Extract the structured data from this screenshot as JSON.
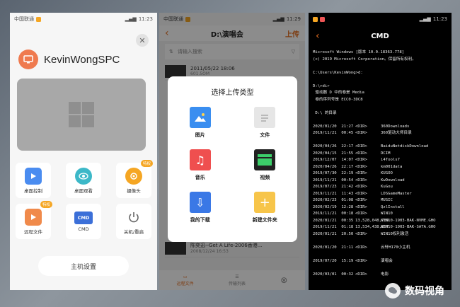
{
  "phone1": {
    "status": {
      "carrier": "中国联通",
      "time": "11:23"
    },
    "device_name": "KevinWongSPC",
    "functions": [
      {
        "label": "桌面控制",
        "icon": "play-icon",
        "tag": ""
      },
      {
        "label": "桌面观看",
        "icon": "eye-icon",
        "tag": ""
      },
      {
        "label": "摄像头",
        "icon": "camera-icon",
        "tag": "特权"
      },
      {
        "label": "远程文件",
        "icon": "folder-icon",
        "tag": "特权"
      },
      {
        "label": "CMD",
        "icon": "cmd-icon",
        "tag": ""
      },
      {
        "label": "关机/重启",
        "icon": "power-icon",
        "tag": ""
      }
    ],
    "host_settings_label": "主机设置",
    "colors": {
      "accent": "#ef7a4f",
      "blue": "#4a8cf0",
      "orange": "#f5a623"
    }
  },
  "phone2": {
    "status": {
      "carrier": "中国联通",
      "time": "11:29"
    },
    "path_title": "D:\\演唱会",
    "upload_label": "上传",
    "search_placeholder": "请输入搜索",
    "list": [
      {
        "name": "2011/05/22 18:06",
        "meta": "601.5OM"
      },
      {
        "name": "陈奕迅--Get A Life-2006香港...",
        "meta": "2008/12/24 16:53"
      }
    ],
    "dialog": {
      "title": "选择上传类型",
      "types": [
        {
          "label": "图片",
          "icon": "image-icon"
        },
        {
          "label": "文件",
          "icon": "file-icon"
        },
        {
          "label": "音乐",
          "icon": "music-icon"
        },
        {
          "label": "视频",
          "icon": "video-icon"
        },
        {
          "label": "我的下载",
          "icon": "download-icon"
        },
        {
          "label": "新建文件夹",
          "icon": "new-folder-icon"
        }
      ]
    },
    "bottom_nav": [
      "远程文件",
      "传输列表",
      ""
    ]
  },
  "phone3": {
    "status": {
      "time": "11:23"
    },
    "title": "CMD",
    "header_lines": [
      "Microsoft Windows [版本 10.0.18363.778]",
      "(c) 2019 Microsoft Corporation。保留所有权利。",
      "",
      "C:\\Users\\KevinWong>d:",
      "",
      "D:\\>dir",
      " 驱动器 D 中的卷是 Media",
      " 卷的序列号是 ECC0-3DC8",
      "",
      " D:\\ 的目录",
      ""
    ],
    "dir_rows": [
      {
        "date": "2020/01/20",
        "time": "21:27",
        "tag": "<DIR>",
        "name": "360Downloads"
      },
      {
        "date": "2019/11/21",
        "time": "00:45",
        "tag": "<DIR>",
        "name": "360驱动大师目录"
      },
      {
        "date": "",
        "time": "",
        "tag": "",
        "name": ""
      },
      {
        "date": "2020/04/26",
        "time": "22:17",
        "tag": "<DIR>",
        "name": "BaiduNetdiskDownload"
      },
      {
        "date": "2020/04/15",
        "time": "21:55",
        "tag": "<DIR>",
        "name": "DCIM"
      },
      {
        "date": "2019/12/07",
        "time": "14:07",
        "tag": "<DIR>",
        "name": "i4Tools7"
      },
      {
        "date": "2020/04/26",
        "time": "22:17",
        "tag": "<DIR>",
        "name": "km001data"
      },
      {
        "date": "2019/07/30",
        "time": "22:19",
        "tag": "<DIR>",
        "name": "KUGOO"
      },
      {
        "date": "2019/11/21",
        "time": "00:54",
        "tag": "<DIR>",
        "name": "KwDownload"
      },
      {
        "date": "2019/07/23",
        "time": "21:42",
        "tag": "<DIR>",
        "name": "KuGou"
      },
      {
        "date": "2019/11/21",
        "time": "11:43",
        "tag": "<DIR>",
        "name": "LDSGameMaster"
      },
      {
        "date": "2020/02/23",
        "time": "01:08",
        "tag": "<DIR>",
        "name": "MUSIC"
      },
      {
        "date": "2020/02/19",
        "time": "12:28",
        "tag": "<DIR>",
        "name": "QzlInstall"
      },
      {
        "date": "2019/11/21",
        "time": "00:18",
        "tag": "<DIR>",
        "name": "WIN10"
      },
      {
        "date": "2020/01/21",
        "time": "00:35",
        "tag": "13,528,048,789",
        "name": "WIN10-1903-BAK-NVME.GHO"
      },
      {
        "date": "2019/11/21",
        "time": "01:18",
        "tag": "13,534,438,857",
        "name": "WIN10-1903-BAK-SATA.GHO"
      },
      {
        "date": "2020/01/21",
        "time": "20:50",
        "tag": "<DIR>",
        "name": "WIN10权利激活"
      },
      {
        "date": "",
        "time": "",
        "tag": "",
        "name": ""
      },
      {
        "date": "2020/01/20",
        "time": "21:11",
        "tag": "<DIR>",
        "name": "云轩H170小主机"
      },
      {
        "date": "",
        "time": "",
        "tag": "",
        "name": ""
      },
      {
        "date": "2019/07/20",
        "time": "15:19",
        "tag": "<DIR>",
        "name": "演唱会"
      },
      {
        "date": "",
        "time": "",
        "tag": "",
        "name": ""
      },
      {
        "date": "2020/03/01",
        "time": "00:32",
        "tag": "<DIR>",
        "name": "电影"
      }
    ]
  },
  "watermark": {
    "text": "数码视角",
    "icon": "wechat-icon"
  }
}
